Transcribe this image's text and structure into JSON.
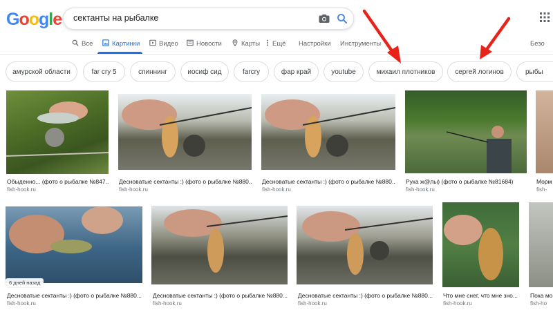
{
  "logo": {
    "text": "Google",
    "letters": [
      "G",
      "o",
      "o",
      "g",
      "l",
      "e"
    ],
    "colors": [
      "#4285F4",
      "#EA4335",
      "#FBBC05",
      "#4285F4",
      "#34A853",
      "#EA4335"
    ]
  },
  "search": {
    "query": "сектанты на рыбалке"
  },
  "tabs": [
    {
      "label": "Все",
      "icon": "search-icon"
    },
    {
      "label": "Картинки",
      "icon": "image-icon",
      "active": true
    },
    {
      "label": "Видео",
      "icon": "video-icon"
    },
    {
      "label": "Новости",
      "icon": "news-icon"
    },
    {
      "label": "Карты",
      "icon": "map-pin-icon"
    },
    {
      "label": "Ещё",
      "icon": "more-dots-icon"
    }
  ],
  "tools": {
    "settings": "Настройки",
    "tools": "Инструменты",
    "safe": "Безо"
  },
  "chips": [
    "амурской области",
    "far cry 5",
    "спиннинг",
    "иосиф сид",
    "farcry",
    "фар край",
    "youtube",
    "михаил плотников",
    "сергей логинов",
    "рыбы"
  ],
  "results": [
    {
      "caption": "Обыденно... (фото о рыбалке №847...",
      "source": "fish-hook.ru"
    },
    {
      "caption": "Десноватые сектанты :) (фото о рыбалке №880...",
      "source": "fish-hook.ru"
    },
    {
      "caption": "Десноватые сектанты :) (фото о рыбалке №880...",
      "source": "fish-hook.ru"
    },
    {
      "caption": "Рука ж@лы) (фото о рыбалке №81684)",
      "source": "fish-hook.ru"
    },
    {
      "caption": "Морм",
      "source": "fish-"
    },
    {
      "caption": "Десноватые сектанты :) (фото о рыбалке №880...",
      "source": "fish-hook.ru",
      "badge": "6 дней назад"
    },
    {
      "caption": "Десноватые сектанты :) (фото о рыбалке №880...",
      "source": "fish-hook.ru"
    },
    {
      "caption": "Десноватые сектанты :) (фото о рыбалке №880...",
      "source": "fish-hook.ru"
    },
    {
      "caption": "Что мне снег, что мне зно...",
      "source": "fish-hook.ru"
    },
    {
      "caption": "Пока мо",
      "source": "fish-ho"
    }
  ],
  "colors": {
    "accent": "#1a73e8",
    "annotation_arrow": "#e8231a"
  }
}
